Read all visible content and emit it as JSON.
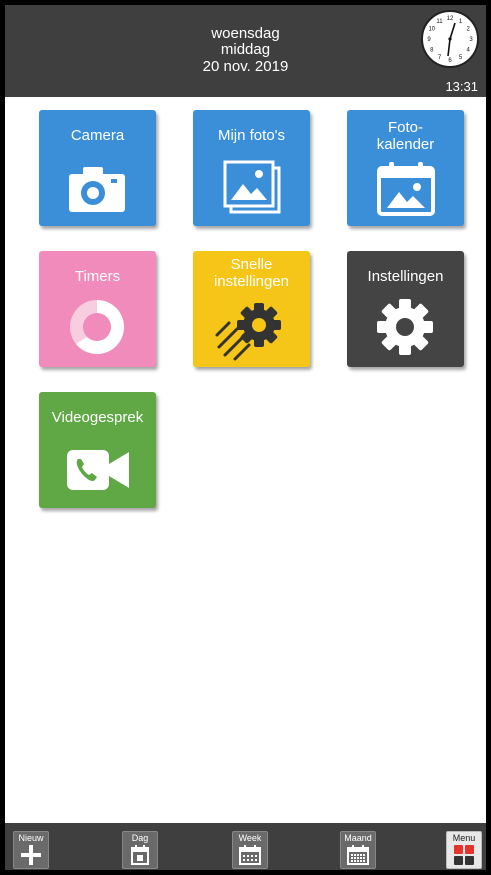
{
  "header": {
    "day": "woensdag",
    "daypart": "middag",
    "date": "20 nov. 2019",
    "time": "13:31",
    "clock_numbers": [
      "12",
      "1",
      "2",
      "3",
      "4",
      "5",
      "6",
      "7",
      "8",
      "9",
      "10",
      "11"
    ]
  },
  "tiles": [
    {
      "label": "Camera",
      "color": "#3b8fd9",
      "icon": "camera-icon"
    },
    {
      "label": "Mijn foto's",
      "color": "#3b8fd9",
      "icon": "photos-icon"
    },
    {
      "label_line1": "Foto-",
      "label_line2": "kalender",
      "color": "#3b8fd9",
      "icon": "photo-calendar-icon"
    },
    {
      "label": "Timers",
      "color": "#f08bbb",
      "icon": "timer-icon"
    },
    {
      "label_line1": "Snelle",
      "label_line2": "instellingen",
      "color": "#f5c518",
      "icon": "quick-settings-icon"
    },
    {
      "label": "Instellingen",
      "color": "#444444",
      "icon": "gear-icon"
    },
    {
      "label": "Videogesprek",
      "color": "#5fa845",
      "icon": "video-call-icon"
    }
  ],
  "bottom_bar": {
    "new_label": "Nieuw",
    "day_label": "Dag",
    "week_label": "Week",
    "month_label": "Maand",
    "menu_label": "Menu"
  }
}
